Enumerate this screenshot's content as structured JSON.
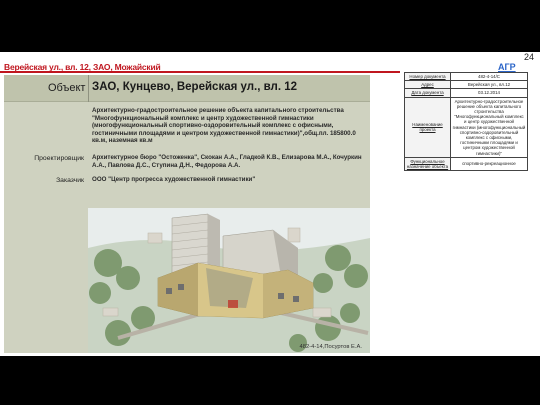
{
  "page_number": "24",
  "agr_link": "АГР",
  "title": "Верейская ул., вл. 12, ЗАО, Можайский",
  "board": {
    "object_label": "Объект",
    "object_value": "ЗАО, Кунцево, Верейская ул., вл. 12",
    "description": "Архитектурно-градостроительное решение объекта капитального строительства \"Многофункциональный комплекс и центр художественной гимнастики (многофункциональный спортивно-оздоровительный комплекс с офисными, гостиничными площадями и центром художественной гимнастики)\",общ.пл. 185800.0 кв.м, наземная кв.м",
    "designer_label": "Проектировщик",
    "designer_value": "Архитектурное бюро \"Остоженка\", Скокан А.А., Гладкой К.В., Елизарова М.А., Кочуркин А.А., Павлова Д.С., Ступина Д.Н., Федорова А.А.",
    "customer_label": "Заказчик",
    "customer_value": "ООО \"Центр прогресса художественной гимнастики\"",
    "render_caption": "482-4-14,Посуртов Е.А."
  },
  "info_table": [
    {
      "key": "Номер документа",
      "value": "482-4-14/С"
    },
    {
      "key": "Адрес",
      "value": "Верейская ул., вл.12"
    },
    {
      "key": "Дата документа",
      "value": "03.12.2014"
    },
    {
      "key": "Наименование проекта",
      "value": "Архитектурно-градостроительное решение объекта капитального строительства \"Многофункциональный комплекс и центр художественной гимнастики (многофункциональный спортивно-оздоровительный комплекс с офисными, гостиничными площадями и центром художественной гимнастики)\""
    },
    {
      "key": "Функциональное назначение объекта",
      "value": "спортивно-рекреационное"
    }
  ]
}
